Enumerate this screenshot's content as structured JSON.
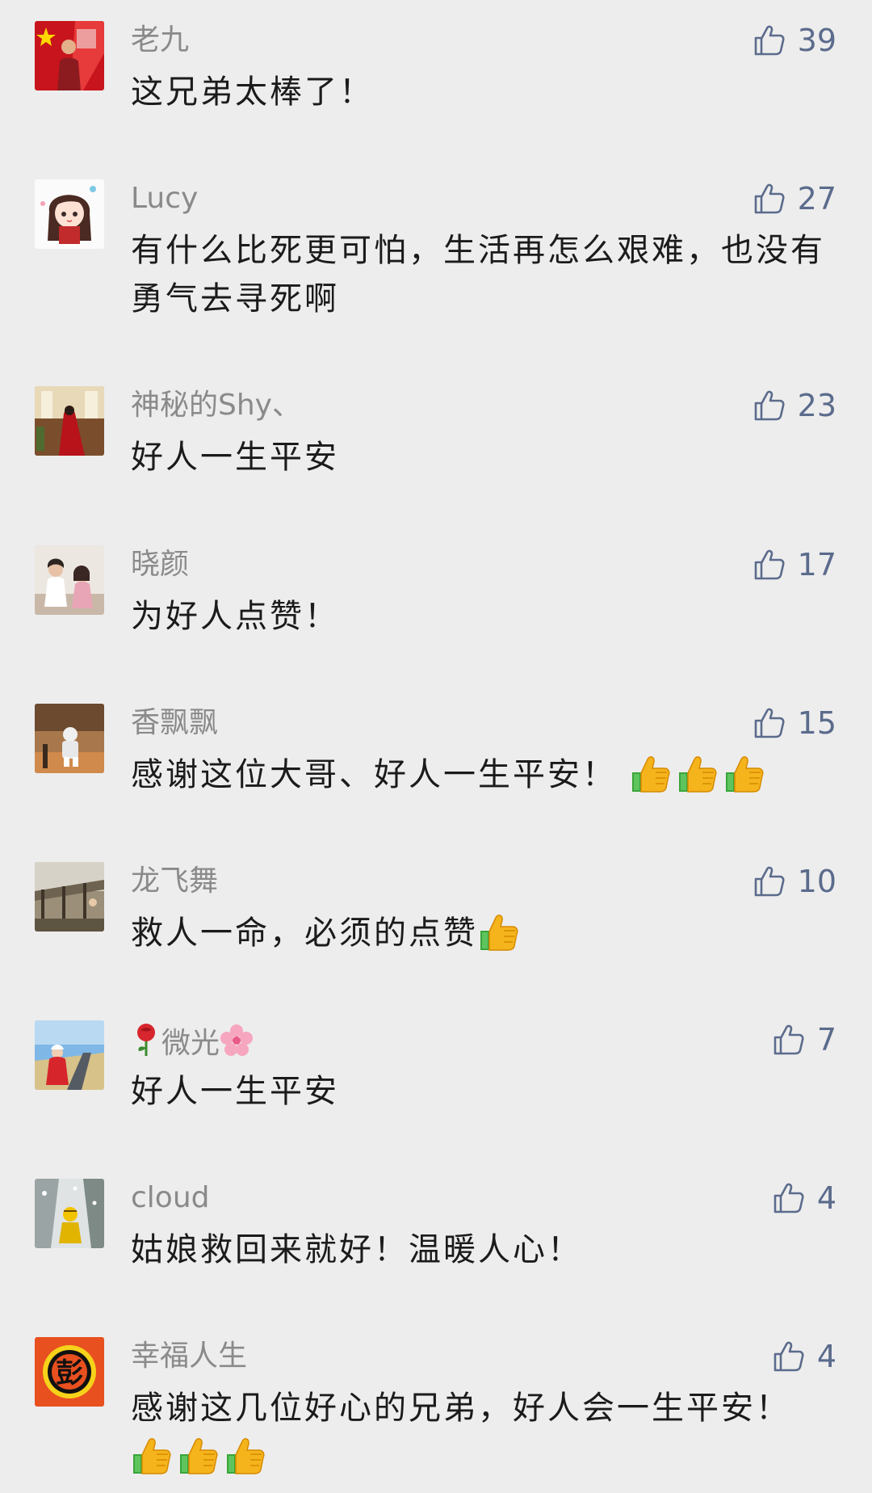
{
  "comments": [
    {
      "name": "老九",
      "text": "这兄弟太棒了！",
      "likes": "39",
      "emoji_count": 0
    },
    {
      "name": "Lucy",
      "text": "有什么比死更可怕，生活再怎么艰难，也没有勇气去寻死啊",
      "likes": "27",
      "emoji_count": 0
    },
    {
      "name": "神秘的Shy、",
      "text": "好人一生平安",
      "likes": "23",
      "emoji_count": 0
    },
    {
      "name": "晓颜",
      "text": "为好人点赞！",
      "likes": "17",
      "emoji_count": 0
    },
    {
      "name": "香飘飘",
      "text": "感谢这位大哥、好人一生平安！",
      "likes": "15",
      "emoji_count": 3
    },
    {
      "name": "龙飞舞",
      "text": "救人一命，必须的点赞",
      "likes": "10",
      "emoji_count": 1
    },
    {
      "name": "微光",
      "text": "好人一生平安",
      "likes": "7",
      "emoji_count": 0
    },
    {
      "name": "cloud",
      "text": "姑娘救回来就好！温暖人心！",
      "likes": "4",
      "emoji_count": 0
    },
    {
      "name": "幸福人生",
      "text": "感谢这几位好心的兄弟，好人会一生平安！",
      "likes": "4",
      "emoji_count": 3
    }
  ],
  "icons": {
    "like": "thumbs-up-outline-icon",
    "emoji": "thumbs-up-emoji-icon",
    "name_deco_left": "rose-icon",
    "name_deco_right": "cherry-blossom-icon"
  },
  "colors": {
    "background": "#ededed",
    "like_blue": "#5b6b8c",
    "name_gray": "#8a8a8a",
    "text": "#1b1b1b"
  },
  "avatar_badge_text": "彭"
}
